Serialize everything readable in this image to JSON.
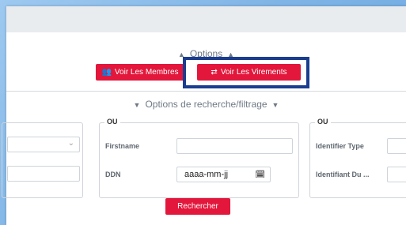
{
  "options": {
    "label": "Options"
  },
  "buttons": {
    "members": "Voir Les Membres",
    "transfers": "Voir Les Virements",
    "search": "Rechercher"
  },
  "filter": {
    "label": "Options de recherche/filtrage"
  },
  "groups": [
    {
      "legend": ""
    },
    {
      "legend": "OU",
      "fields": [
        {
          "label": "Firstname"
        },
        {
          "label": "DDN",
          "placeholder": "aaaa-mm-jj"
        }
      ]
    },
    {
      "legend": "OU",
      "fields": [
        {
          "label": "Identifier Type"
        },
        {
          "label": "Identifiant Du ..."
        }
      ]
    }
  ],
  "icons": {
    "members": "users-icon",
    "transfers": "exchange-icon",
    "calendar": "calendar-icon",
    "chevron": "chevron-down-icon"
  },
  "colors": {
    "accent": "#e2173b",
    "highlight": "#1a3d8f",
    "header": "#e9ecef"
  }
}
